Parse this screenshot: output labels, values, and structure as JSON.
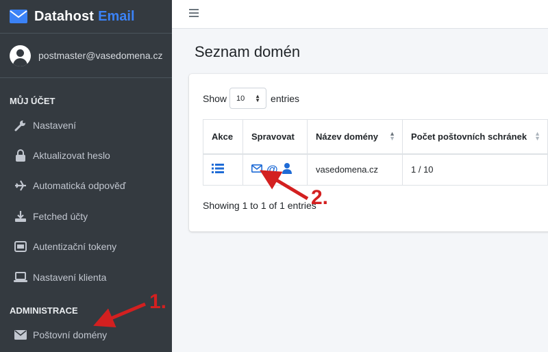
{
  "brand": {
    "name": "Datahost",
    "accent": "Email"
  },
  "user": {
    "email": "postmaster@vasedomena.cz"
  },
  "sidebar": {
    "section_account": "MŮJ ÚČET",
    "section_admin": "ADMINISTRACE",
    "items": [
      {
        "label": "Nastavení",
        "icon": "wrench-icon"
      },
      {
        "label": "Aktualizovat heslo",
        "icon": "lock-icon"
      },
      {
        "label": "Automatická odpověď",
        "icon": "plane-icon"
      },
      {
        "label": "Fetched účty",
        "icon": "download-icon"
      },
      {
        "label": "Autentizační tokeny",
        "icon": "token-icon"
      },
      {
        "label": "Nastavení klienta",
        "icon": "laptop-icon"
      },
      {
        "label": "Poštovní domény",
        "icon": "envelope-icon"
      }
    ]
  },
  "page": {
    "title": "Seznam domén"
  },
  "table_controls": {
    "show_label": "Show",
    "entries_label": "entries",
    "page_size": "10"
  },
  "table": {
    "columns": [
      "Akce",
      "Spravovat",
      "Název domény",
      "Počet poštovních schránek"
    ],
    "rows": [
      {
        "domain": "vasedomena.cz",
        "mailboxes": "1 / 10"
      }
    ],
    "info": "Showing 1 to 1 of 1 entries"
  },
  "annotations": {
    "step1": "1.",
    "step2": "2."
  },
  "colors": {
    "sidebar": "#343a40",
    "accent": "#3b82f6",
    "icon_blue": "#1e6bd6",
    "annotation": "#d32020"
  }
}
